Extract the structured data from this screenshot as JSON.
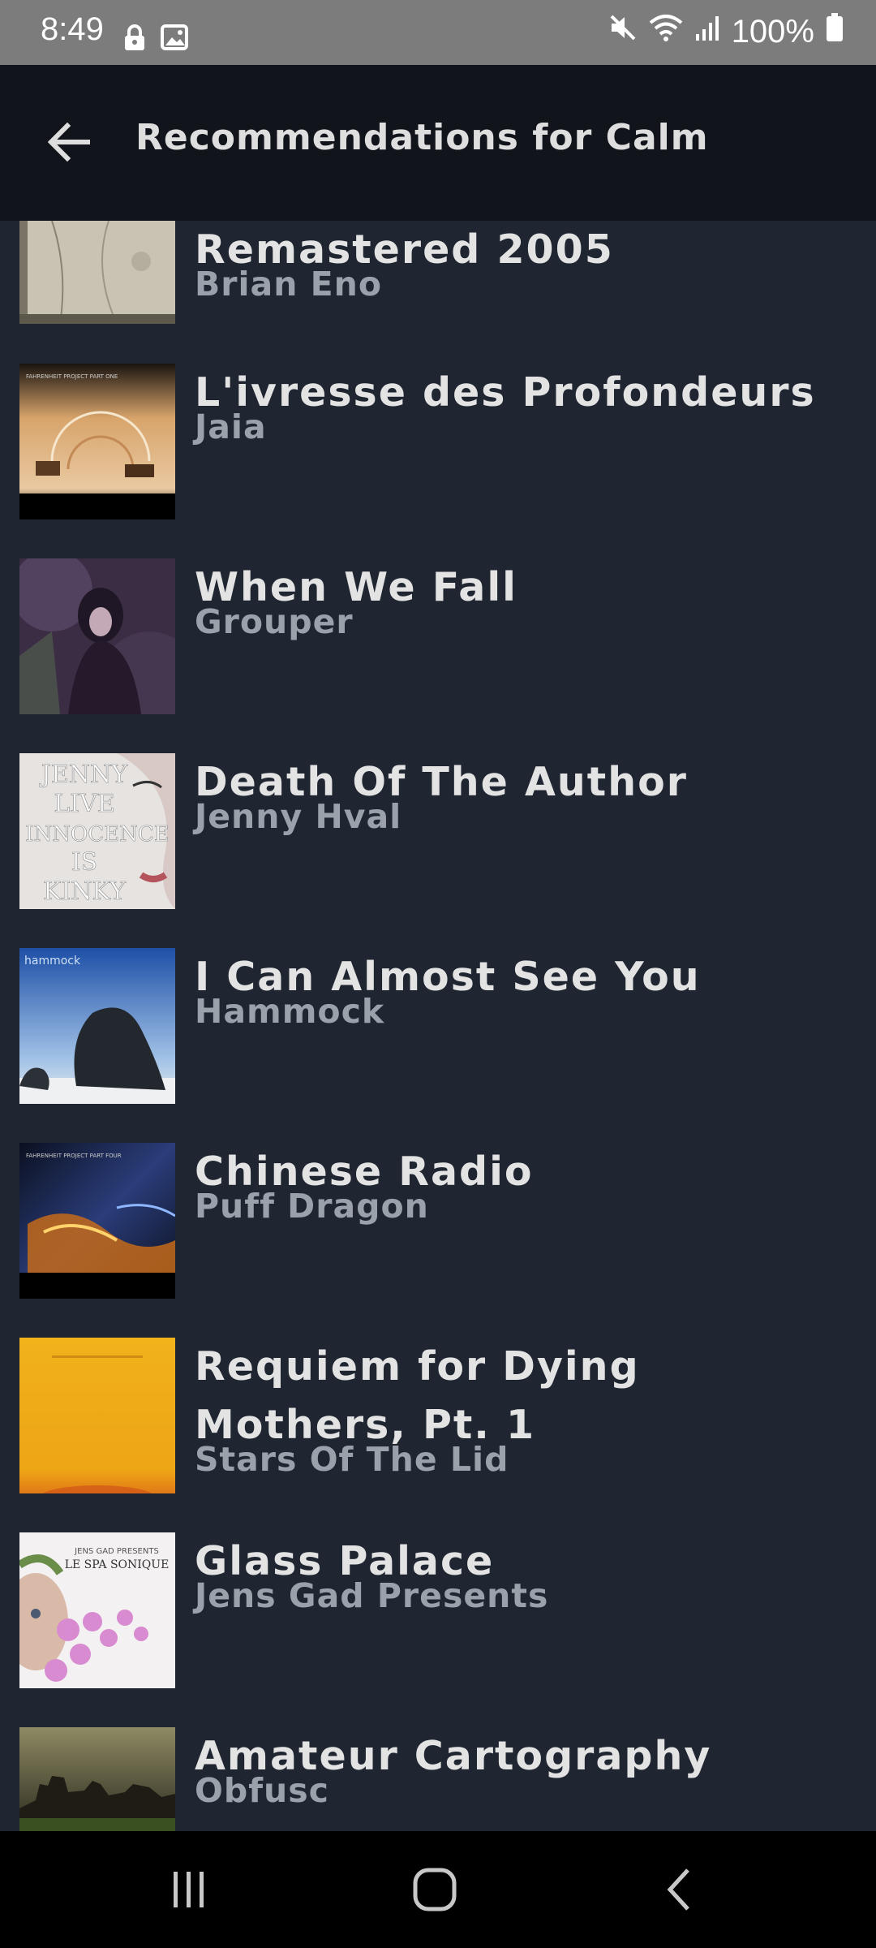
{
  "status_bar": {
    "time": "8:49",
    "battery": "100%",
    "icons": [
      "lock-icon",
      "image-icon",
      "mute-icon",
      "wifi-icon",
      "signal-icon",
      "battery-icon"
    ]
  },
  "app_bar": {
    "title": "Recommendations for Calm",
    "back_icon": "arrow-left-icon"
  },
  "tracks": [
    {
      "title": "Remastered 2005",
      "artist": "Brian Eno",
      "cover": "grey-textured"
    },
    {
      "title": "L'ivresse des Profondeurs",
      "artist": "Jaia",
      "cover": "fahrenheit-project-part-one"
    },
    {
      "title": "When We Fall",
      "artist": "Grouper",
      "cover": "purple-forest-photo"
    },
    {
      "title": "Death Of The Author",
      "artist": "Jenny Hval",
      "cover": "jenny-hval-innocence-is-kinky"
    },
    {
      "title": "I Can Almost See You",
      "artist": "Hammock",
      "cover": "hammock-rock-blue-sky"
    },
    {
      "title": "Chinese Radio",
      "artist": "Puff Dragon",
      "cover": "fahrenheit-project-part-four"
    },
    {
      "title": "Requiem for Dying Mothers, Pt. 1",
      "artist": "Stars Of The Lid",
      "cover": "yellow-orange"
    },
    {
      "title": "Glass Palace",
      "artist": "Jens Gad Presents",
      "cover": "le-spa-sonique-orchid"
    },
    {
      "title": "Amateur Cartography",
      "artist": "Obfusc",
      "cover": "dusky-city"
    }
  ],
  "cover_text": {
    "fahrenheit_one": "FAHRENHEIT PROJECT   PART ONE",
    "jenny": [
      "JENNY",
      "LIVE",
      "INNOCENCE",
      "IS",
      "KINKY"
    ],
    "hammock": "hammock",
    "fahrenheit_four": "FAHRENHEIT PROJECT   PART FOUR",
    "jens_gad": "JENS GAD PRESENTS",
    "le_spa": "LE SPA SONIQUE"
  },
  "colors": {
    "background": "#1f2631",
    "app_bar": "#11141b",
    "status_bar": "#7c7c7c",
    "title_text": "#e3e3e3",
    "artist_text": "#9ba1aa"
  },
  "nav_bar": {
    "recents_icon": "recents-icon",
    "home_icon": "home-icon",
    "back_icon": "nav-back-icon"
  }
}
